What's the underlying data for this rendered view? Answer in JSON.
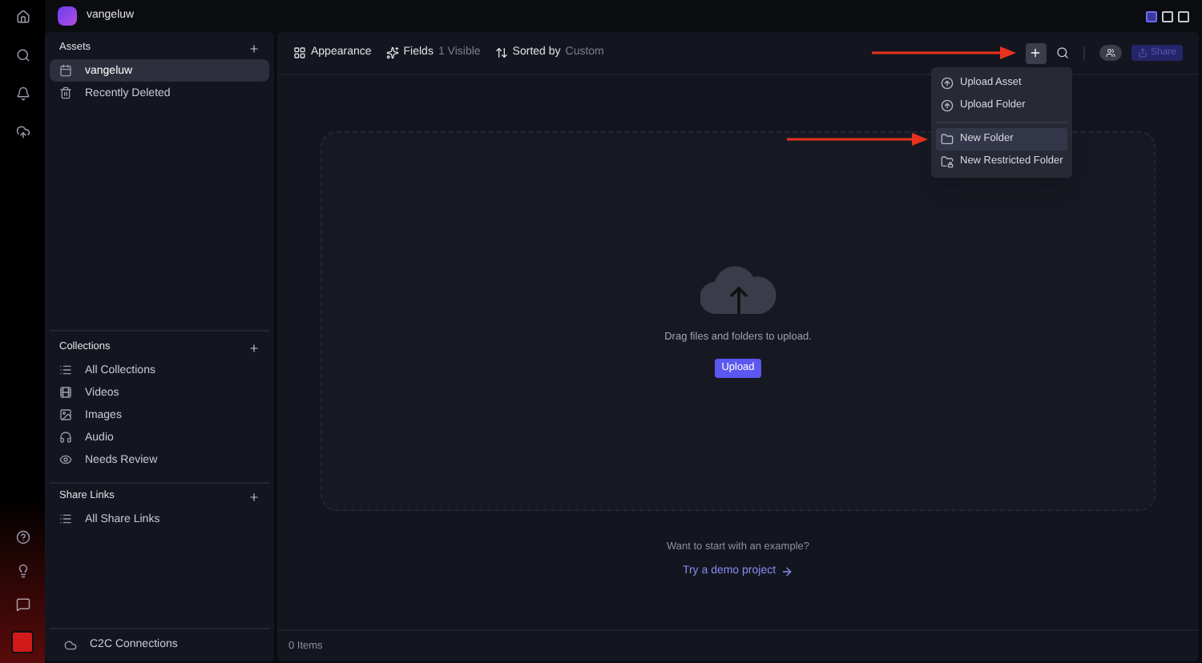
{
  "workspace": {
    "name": "vangeluw"
  },
  "layout_toggles": [
    {
      "selected": true
    },
    {
      "selected": false
    },
    {
      "selected": false
    }
  ],
  "assets": {
    "title": "Assets",
    "items": [
      {
        "label": "vangeluw",
        "kind": "project",
        "selected": true
      },
      {
        "label": "Recently Deleted",
        "kind": "trash",
        "selected": false
      }
    ]
  },
  "collections": {
    "title": "Collections",
    "items": [
      {
        "label": "All Collections",
        "kind": "list"
      },
      {
        "label": "Videos",
        "kind": "video"
      },
      {
        "label": "Images",
        "kind": "image"
      },
      {
        "label": "Audio",
        "kind": "audio"
      },
      {
        "label": "Needs Review",
        "kind": "review"
      }
    ]
  },
  "share_links": {
    "title": "Share Links",
    "items": [
      {
        "label": "All Share Links",
        "kind": "list"
      }
    ]
  },
  "c2c": {
    "label": "C2C Connections"
  },
  "toolbar": {
    "appearance": "Appearance",
    "fields": "Fields",
    "fields_count": "1 Visible",
    "sorted": "Sorted by",
    "sort_value": "Custom",
    "share": "Share"
  },
  "menu": {
    "items": [
      {
        "label": "Upload Asset",
        "kind": "upload",
        "selected": false
      },
      {
        "label": "Upload Folder",
        "kind": "upload",
        "selected": false
      },
      {
        "label": "New Folder",
        "kind": "folder",
        "selected": true
      },
      {
        "label": "New Restricted Folder",
        "kind": "restricted",
        "selected": false
      }
    ]
  },
  "dropzone": {
    "text": "Drag files and folders to upload.",
    "button": "Upload"
  },
  "demo": {
    "question": "Want to start with an example?",
    "link": "Try a demo project"
  },
  "status": {
    "count": "0 Items"
  }
}
